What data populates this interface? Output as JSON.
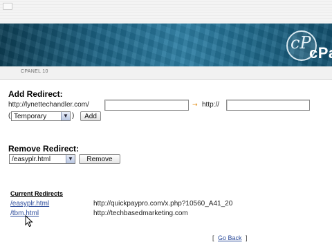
{
  "panel": {
    "brand": "cPa",
    "nav_home": "CPANEL 10"
  },
  "add_redirect": {
    "title": "Add Redirect:",
    "domain_prefix": "http://lynettechandler.com/",
    "separator": "→",
    "target_prefix": "http://",
    "path_value": "",
    "url_value": "",
    "type_selected": "Temporary",
    "paren_open": "(",
    "paren_close": ")",
    "add_label": "Add"
  },
  "remove_redirect": {
    "title": "Remove Redirect:",
    "selected": "/easyplr.html",
    "remove_label": "Remove"
  },
  "current_redirects": {
    "title": "Current Redirects",
    "rows": [
      {
        "path": "/easyplr.html",
        "target": "http://quickpaypro.com/x.php?10560_A41_20"
      },
      {
        "path": "/tbm.html",
        "target": "http://techbasedmarketing.com"
      }
    ]
  },
  "go_back": {
    "open": "[",
    "label": "Go Back",
    "close": "]"
  },
  "colors": {
    "banner": "#1c6384",
    "link": "#2a4a9a",
    "accent": "#e08a12"
  }
}
